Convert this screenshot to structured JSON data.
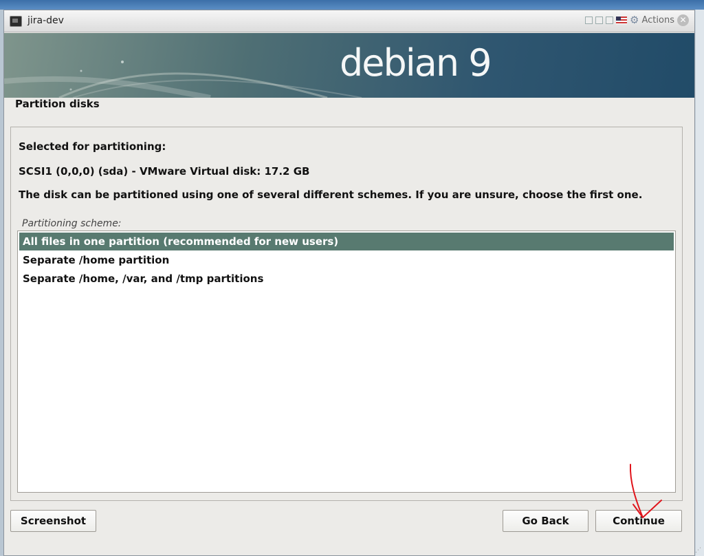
{
  "window": {
    "title": "jira-dev",
    "actions_label": "Actions",
    "close_glyph": "✕",
    "gear_glyph": "⚙"
  },
  "banner": {
    "logo_text": "debian 9"
  },
  "page": {
    "heading": "Partition disks",
    "selected_label": "Selected for partitioning:",
    "disk_info": "SCSI1 (0,0,0) (sda) - VMware Virtual disk: 17.2 GB",
    "explanation": "The disk can be partitioned using one of several different schemes. If you are unsure, choose the first one.",
    "scheme_label": "Partitioning scheme:"
  },
  "options": [
    {
      "label": "All files in one partition (recommended for new users)",
      "selected": true
    },
    {
      "label": "Separate /home partition",
      "selected": false
    },
    {
      "label": "Separate /home, /var, and /tmp partitions",
      "selected": false
    }
  ],
  "buttons": {
    "screenshot": "Screenshot",
    "go_back": "Go Back",
    "continue": "Continue"
  },
  "colors": {
    "selected_row": "#587a70",
    "annotation": "#e0141b"
  }
}
